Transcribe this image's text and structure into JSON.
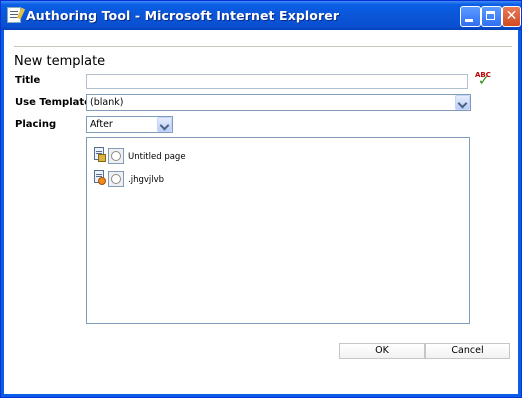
{
  "window": {
    "title": "Authoring Tool - Microsoft Internet Explorer",
    "icons": {
      "app": "document-pen-icon",
      "minimize": "minimize-icon",
      "maximize": "maximize-icon",
      "close": "close-icon"
    },
    "close_glyph": "✕"
  },
  "form": {
    "heading": "New template",
    "title_label": "Title",
    "title_value": "",
    "spellcheck": {
      "text": "ABC",
      "icon": "spellcheck-icon"
    },
    "use_template_label": "Use Template",
    "use_template_value": "(blank)",
    "placing_label": "Placing",
    "placing_value": "After"
  },
  "tree": {
    "items": [
      {
        "label": "Untitled page",
        "icon": "page-folder-icon",
        "selected": false
      },
      {
        "label": ".jhgvjlvb",
        "icon": "page-orange-icon",
        "selected": false
      }
    ]
  },
  "buttons": {
    "ok": "OK",
    "cancel": "Cancel"
  },
  "colors": {
    "titlebar": "#0a5ee6",
    "close_button": "#d14a21",
    "border": "#7f9db9"
  }
}
